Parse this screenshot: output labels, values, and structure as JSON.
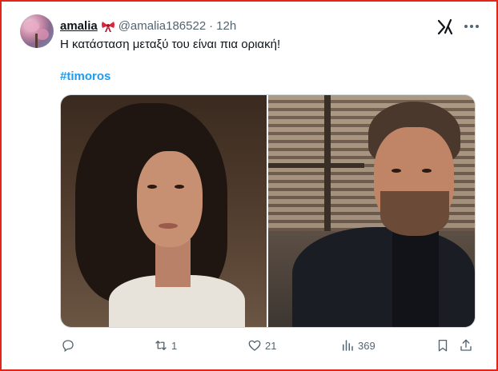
{
  "tweet": {
    "display_name": "amalia",
    "handle": "@amalia186522",
    "separator": "·",
    "time": "12h",
    "text": "Η κατάσταση μεταξύ του είναι πια οριακή!",
    "hashtag": "#timoros"
  },
  "icons": {
    "name_emoji": "bow-icon",
    "grok": "grok-icon",
    "more": "more-icon",
    "reply": "reply-icon",
    "repost": "repost-icon",
    "like": "heart-icon",
    "views": "views-chart-icon",
    "bookmark": "bookmark-icon",
    "share": "share-icon"
  },
  "stats": {
    "replies": "",
    "reposts": "1",
    "likes": "21",
    "views": "369"
  },
  "colors": {
    "hashtag": "#1d9bf0",
    "secondary_text": "#536471",
    "frame_border": "#e0251b",
    "bow": "#d7263d"
  }
}
